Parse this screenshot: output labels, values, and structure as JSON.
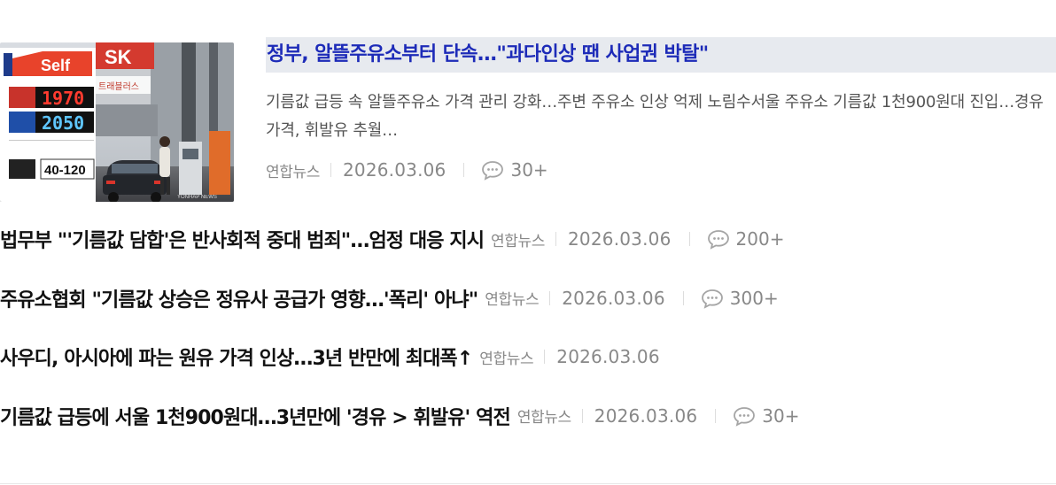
{
  "featured": {
    "title": "정부, 알뜰주유소부터 단속…\"과다인상 땐 사업권 박탈\"",
    "summary": "기름값 급등 속 알뜰주유소 가격 관리 강화…주변 주유소 인상 억제 노림수서울 주유소 기름값 1천900원대 진입…경유 가격, 휘발유 추월…",
    "press": "연합뉴스",
    "date": "2026.03.06",
    "comments": "30+",
    "thumbnail": {
      "brand_left": "Self",
      "brand_right": "SK",
      "sign_text": "트래블러스",
      "price_1": "1970",
      "price_2": "2050",
      "price_3": "40-120",
      "watermark": "YONHAP NEWS"
    }
  },
  "articles": [
    {
      "title": "법무부 \"'기름값 담합'은 반사회적 중대 범죄\"…엄정 대응 지시",
      "press": "연합뉴스",
      "date": "2026.03.06",
      "comments": "200+"
    },
    {
      "title": "주유소협회 \"기름값 상승은 정유사 공급가 영향…'폭리' 아냐\"",
      "press": "연합뉴스",
      "date": "2026.03.06",
      "comments": "300+"
    },
    {
      "title": "사우디, 아시아에 파는 원유 가격 인상…3년 반만에 최대폭↑",
      "press": "연합뉴스",
      "date": "2026.03.06",
      "comments": null
    },
    {
      "title": "기름값 급등에 서울 1천900원대…3년만에 '경유 > 휘발유' 역전",
      "press": "연합뉴스",
      "date": "2026.03.06",
      "comments": "30+"
    }
  ],
  "colors": {
    "featured_title": "#1d2bb8",
    "featured_title_bg": "#e7eaef",
    "meta_text": "#888888",
    "headline": "#111111"
  },
  "icons": {
    "comment": "speech-bubble-icon"
  }
}
